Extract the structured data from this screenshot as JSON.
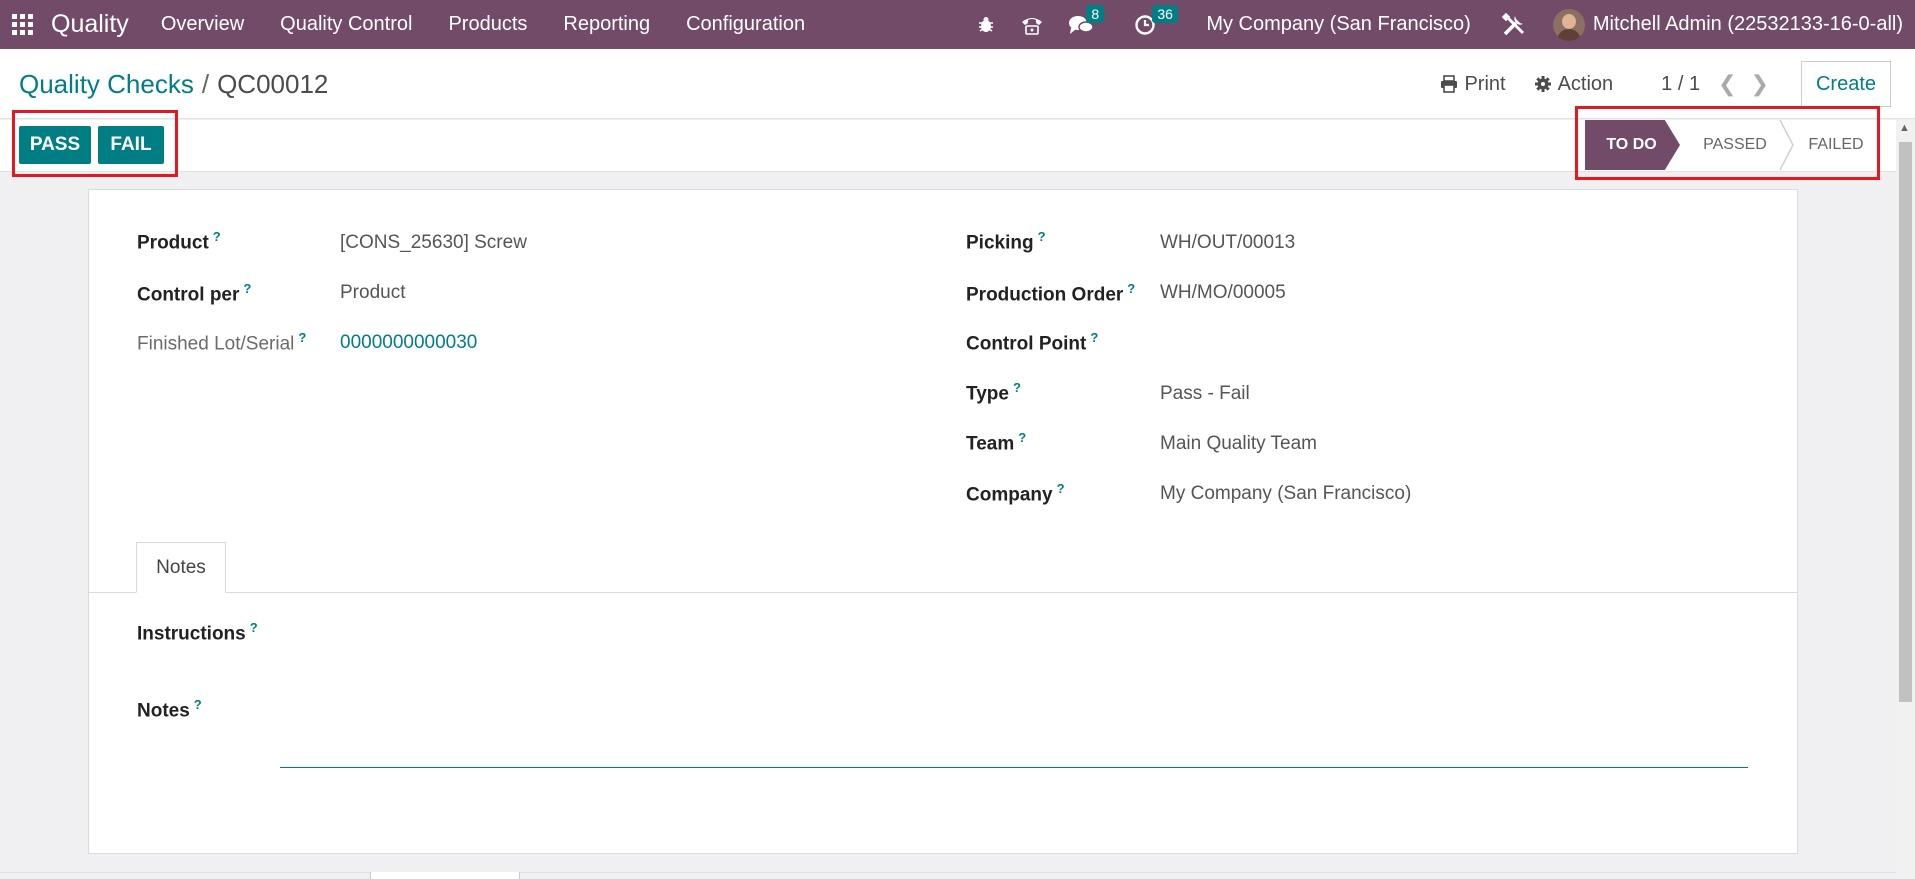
{
  "navbar": {
    "app_name": "Quality",
    "menu": [
      "Overview",
      "Quality Control",
      "Products",
      "Reporting",
      "Configuration"
    ],
    "messages_count": "8",
    "activities_count": "36",
    "company": "My Company (San Francisco)",
    "user": "Mitchell Admin (22532133-16-0-all)",
    "bar_color": "#714b67"
  },
  "control_panel": {
    "breadcrumb_parent": "Quality Checks",
    "breadcrumb_sep": "/",
    "breadcrumb_current": "QC00012",
    "print_label": "Print",
    "action_label": "Action",
    "pager": "1 / 1",
    "create_label": "Create"
  },
  "status": {
    "pass_label": "PASS",
    "fail_label": "FAIL",
    "stages": [
      "TO DO",
      "PASSED",
      "FAILED"
    ],
    "active_stage": "TO DO",
    "accent": "#017e84",
    "highlight": "#e3191f"
  },
  "form": {
    "left": [
      {
        "label": "Product",
        "value": "[CONS_25630] Screw"
      },
      {
        "label": "Control per",
        "value": "Product"
      },
      {
        "label": "Finished Lot/Serial",
        "value": "0000000000030"
      }
    ],
    "right": [
      {
        "label": "Picking",
        "value": "WH/OUT/00013"
      },
      {
        "label": "Production Order",
        "value": "WH/MO/00005"
      },
      {
        "label": "Control Point",
        "value": ""
      },
      {
        "label": "Type",
        "value": "Pass - Fail"
      },
      {
        "label": "Team",
        "value": "Main Quality Team"
      },
      {
        "label": "Company",
        "value": "My Company (San Francisco)"
      }
    ],
    "help_mark": "?",
    "tab_notes": "Notes",
    "instructions_label": "Instructions",
    "notes_label": "Notes"
  }
}
